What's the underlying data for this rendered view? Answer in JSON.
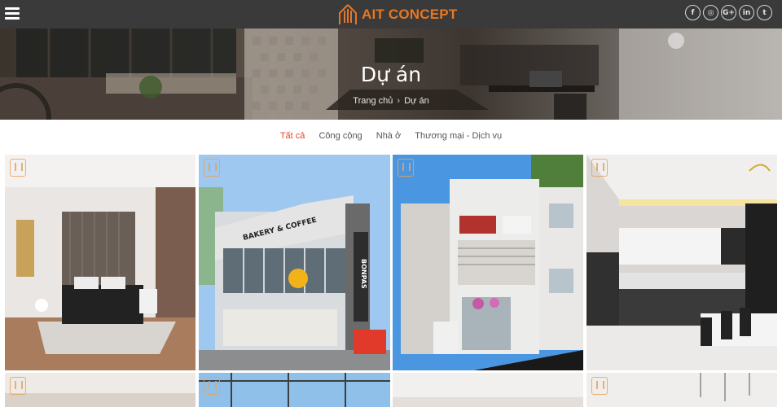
{
  "header": {
    "brand": "AIT CONCEPT",
    "menu_icon": "hamburger-menu-icon",
    "socials": [
      {
        "name": "facebook-icon",
        "glyph": "f"
      },
      {
        "name": "instagram-icon",
        "glyph": "◎"
      },
      {
        "name": "google-plus-icon",
        "glyph": "G+"
      },
      {
        "name": "linkedin-icon",
        "glyph": "in"
      },
      {
        "name": "twitter-icon",
        "glyph": "t"
      }
    ]
  },
  "hero": {
    "title": "Dự án",
    "breadcrumb": {
      "home": "Trang chủ",
      "separator": "›",
      "current": "Dự án"
    }
  },
  "filters": {
    "all": "Tất cả",
    "public": "Công cộng",
    "house": "Nhà ở",
    "commercial": "Thương mại - Dịch vụ"
  },
  "colors": {
    "brand_orange": "#e87722",
    "active_filter": "#e8442a",
    "topbar": "#3a3a3a"
  },
  "projects": [
    {
      "name": "project-bedroom"
    },
    {
      "name": "project-bakery-coffee"
    },
    {
      "name": "project-townhouse"
    },
    {
      "name": "project-kitchen"
    },
    {
      "name": "project-interior-2"
    },
    {
      "name": "project-facade-2"
    },
    {
      "name": "project-interior-3"
    },
    {
      "name": "project-dining"
    }
  ],
  "signage": {
    "bakery": "BAKERY & COFFEE",
    "bonpas": "BONPAS"
  }
}
